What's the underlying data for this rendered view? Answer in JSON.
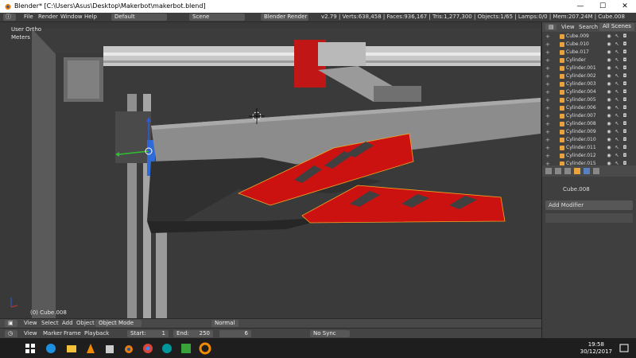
{
  "titlebar": {
    "title": "Blender* [C:\\Users\\Asus\\Desktop\\Makerbot\\makerbot.blend]",
    "min": "—",
    "max": "☐",
    "close": "✕"
  },
  "info": {
    "menus": [
      "File",
      "Render",
      "Window",
      "Help"
    ],
    "layout": "Default",
    "scene": "Scene",
    "engine": "Blender Render",
    "stats": "v2.79 | Verts:638,458 | Faces:936,167 | Tris:1,277,300 | Objects:1/65 | Lamps:0/0 | Mem:207.24M | Cube.008"
  },
  "viewport": {
    "view_name": "User Ortho",
    "units": "Meters",
    "object_label": "(0) Cube.008"
  },
  "outliner": {
    "tab_view": "View",
    "tab_search": "Search",
    "tab_scenes": "All Scenes",
    "items": [
      "Cube.009",
      "Cube.010",
      "Cube.017",
      "Cylinder",
      "Cylinder.001",
      "Cylinder.002",
      "Cylinder.003",
      "Cylinder.004",
      "Cylinder.005",
      "Cylinder.006",
      "Cylinder.007",
      "Cylinder.008",
      "Cylinder.009",
      "Cylinder.010",
      "Cylinder.011",
      "Cylinder.012",
      "Cylinder.015"
    ]
  },
  "properties": {
    "object_name": "Cube.008",
    "add_modifier": "Add Modifier"
  },
  "timeline": {
    "menus": [
      "View",
      "Select",
      "Add",
      "Object"
    ],
    "mode": "Object Mode",
    "shading": "Normal",
    "menus2": [
      "View",
      "Marker",
      "Frame",
      "Playback"
    ],
    "start_label": "Start:",
    "start": "1",
    "end_label": "End:",
    "end": "250",
    "frame": "6",
    "sync": "No Sync"
  },
  "taskbar": {
    "time": "19:58",
    "date": "30/12/2017"
  },
  "colors": {
    "accent_red": "#cc1111",
    "selection_orange": "#f5a623"
  }
}
